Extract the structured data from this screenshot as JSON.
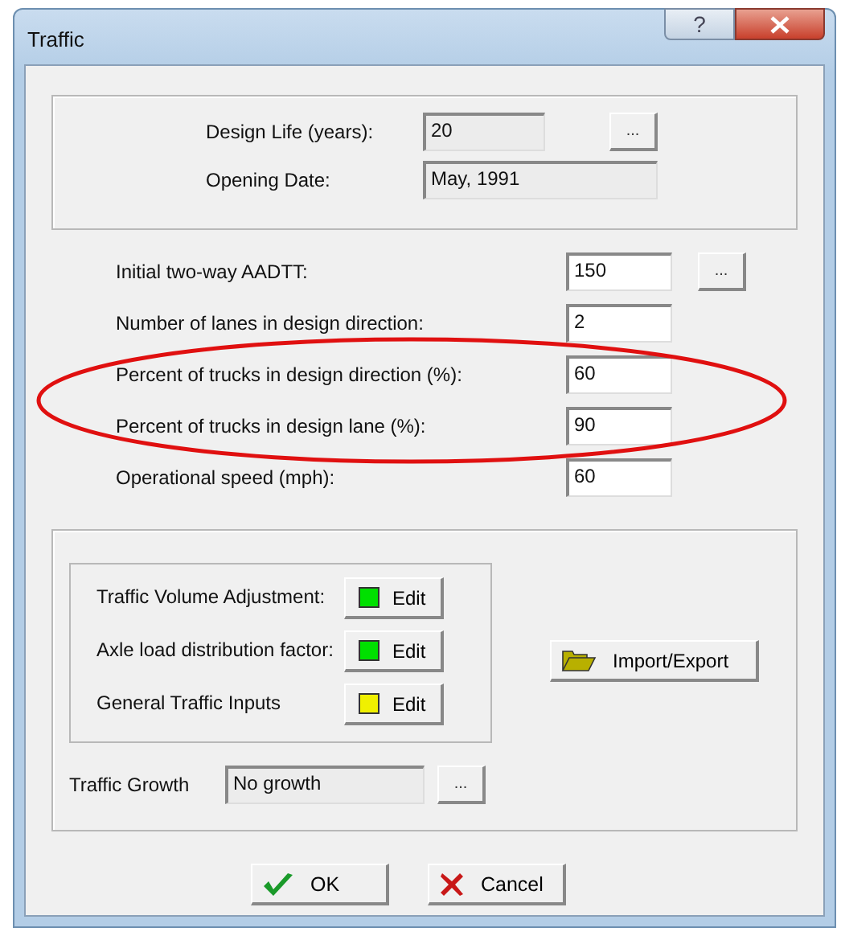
{
  "window": {
    "title": "Traffic",
    "help_button": "?"
  },
  "design": {
    "fields": [
      {
        "label": "Design Life (years):",
        "value": "20",
        "browse": "..."
      },
      {
        "label": "Opening Date:",
        "value": "May, 1991"
      }
    ]
  },
  "inputs": [
    {
      "label": "Initial two-way AADTT:",
      "value": "150",
      "browse": "...",
      "highlighted": false
    },
    {
      "label": "Number of lanes in design direction:",
      "value": "2",
      "highlighted": false
    },
    {
      "label": "Percent of trucks in design direction (%):",
      "value": "60",
      "highlighted": true
    },
    {
      "label": "Percent of trucks in design lane (%):",
      "value": "90",
      "highlighted": true
    },
    {
      "label": "Operational speed (mph):",
      "value": "60",
      "highlighted": false
    }
  ],
  "adjustments": [
    {
      "label": "Traffic Volume Adjustment:",
      "button": "Edit",
      "color": "#00e000"
    },
    {
      "label": "Axle load distribution factor:",
      "button": "Edit",
      "color": "#00e000"
    },
    {
      "label": "General Traffic Inputs",
      "button": "Edit",
      "color": "#f0f000"
    }
  ],
  "import_export": "Import/Export",
  "traffic_growth": {
    "label": "Traffic Growth",
    "value": "No growth",
    "browse": "..."
  },
  "buttons": [
    {
      "kind": "ok",
      "label": "OK"
    },
    {
      "kind": "cancel",
      "label": "Cancel"
    }
  ]
}
